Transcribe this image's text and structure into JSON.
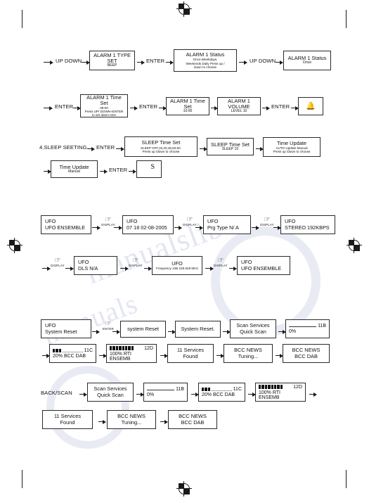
{
  "document": {
    "type": "dab-radio-user-manual-flowchart-page",
    "watermark": [
      "manualslib",
      "manuals"
    ]
  },
  "icons": {
    "hand_press": "☞",
    "bell": "🔔",
    "arrow_right": "arrow-right"
  },
  "rows": {
    "alarm_type": {
      "label_updown": "UP DOWN",
      "label_enter": "ENTER",
      "label_updown2": "UP DOWN",
      "screens": [
        {
          "l1": "ALARM 1 TYPE SET",
          "l2": "BEEP"
        },
        {
          "l1": "ALARM 1 Status",
          "l2": "Once,Weekdays,",
          "l3": "Weekends  Daily  Press up /",
          "l4": "down to choose"
        },
        {
          "l1": "ALARM 1 Status",
          "l2": "Once"
        }
      ]
    },
    "alarm_time": {
      "label_enter1": "ENTER",
      "label_enter2": "ENTER",
      "label_enter3": "ENTER",
      "screens": [
        {
          "l1": "ALARM 1 Time Set",
          "l2": "08:00",
          "l3": "Press UP/ DOWN+ENTER",
          "l4": "to set alarm time"
        },
        {
          "l1": "ALARM 1 Time Set",
          "l2": "10:00"
        },
        {
          "l1": "ALARM 1 VOLUME",
          "l2": "LEVEL 10"
        },
        {
          "l1": "",
          "icon": "bell"
        }
      ]
    },
    "sleep": {
      "heading": "4.SLEEP SEETING",
      "label_enter1": "ENTER",
      "label_enter2": "ENTER",
      "screens": [
        {
          "l1": "SLEEP Time Set",
          "l2": "SLEEP OFF,15,30,45,60,90.",
          "l3": "Press up /down to choose"
        },
        {
          "l1": "SLEEP  Time Set",
          "l2": "SLEEP  15"
        },
        {
          "l1": "Time Update",
          "l2": "AUTO Update Manual",
          "l3": "Press up /down to choose"
        },
        {
          "l1": "Time Update",
          "l2": "Manual"
        },
        {
          "l1": "S"
        }
      ]
    },
    "ufo_display_1": {
      "key": "DISPLAY",
      "screens": [
        {
          "l1": "UFO",
          "l2": "UFO ENSEMBLE"
        },
        {
          "l1": "UFO",
          "l2": "07 18 02-08-2005"
        },
        {
          "l1": "UFO",
          "l2": "Prg Type N/ A"
        },
        {
          "l1": "UFO",
          "l2": "STEREO 192KBPS"
        }
      ]
    },
    "ufo_display_2": {
      "key": "DISPLAY",
      "screens": [
        {
          "l1": "UFO",
          "l2": "DLS N/A"
        },
        {
          "l1": "UFO",
          "l2": "Frequency 12B 225.648 MHz"
        },
        {
          "l1": "UFO",
          "l2": "UFO ENSEMBLE"
        }
      ]
    },
    "system_reset": {
      "key_enter": "ENTER",
      "screens": [
        {
          "l1": "UFO",
          "l2": "System Reset"
        },
        {
          "l1": "system Reset"
        },
        {
          "l1": "System Reset."
        },
        {
          "l1": "Scan Services",
          "l2": "Quick Scan"
        }
      ],
      "progress": [
        {
          "channel": "11B",
          "percent": "0%",
          "filled": 0,
          "style": "line"
        },
        {
          "channel": "11C",
          "percent": "20% BCC DAB",
          "filled": 3,
          "style": "dots"
        },
        {
          "channel": "12D",
          "percent": "100% RTI ENSEMB",
          "filled": 8,
          "style": "solid"
        }
      ],
      "tail": [
        {
          "l1": "11 Services",
          "l2": "Found"
        },
        {
          "l1": "BCC NEWS",
          "l2": "Tuning..."
        },
        {
          "l1": "BCC NEWS",
          "l2": "BCC DAB"
        }
      ]
    },
    "back_scan": {
      "label": "BACK/SCAN",
      "screens": [
        {
          "l1": "Scan Services",
          "l2": "Quick Scan"
        }
      ],
      "progress": [
        {
          "channel": "11B",
          "percent": "0%",
          "filled": 0,
          "style": "line"
        },
        {
          "channel": "11C",
          "percent": "20% BCC DAB",
          "filled": 3,
          "style": "dots"
        },
        {
          "channel": "12D",
          "percent": "100% RTI ENSEMB",
          "filled": 8,
          "style": "solid"
        }
      ],
      "tail": [
        {
          "l1": "11 Services",
          "l2": "Found"
        },
        {
          "l1": "BCC NEWS",
          "l2": "Tuning..."
        },
        {
          "l1": "BCC NEWS",
          "l2": "BCC DAB"
        }
      ]
    }
  }
}
